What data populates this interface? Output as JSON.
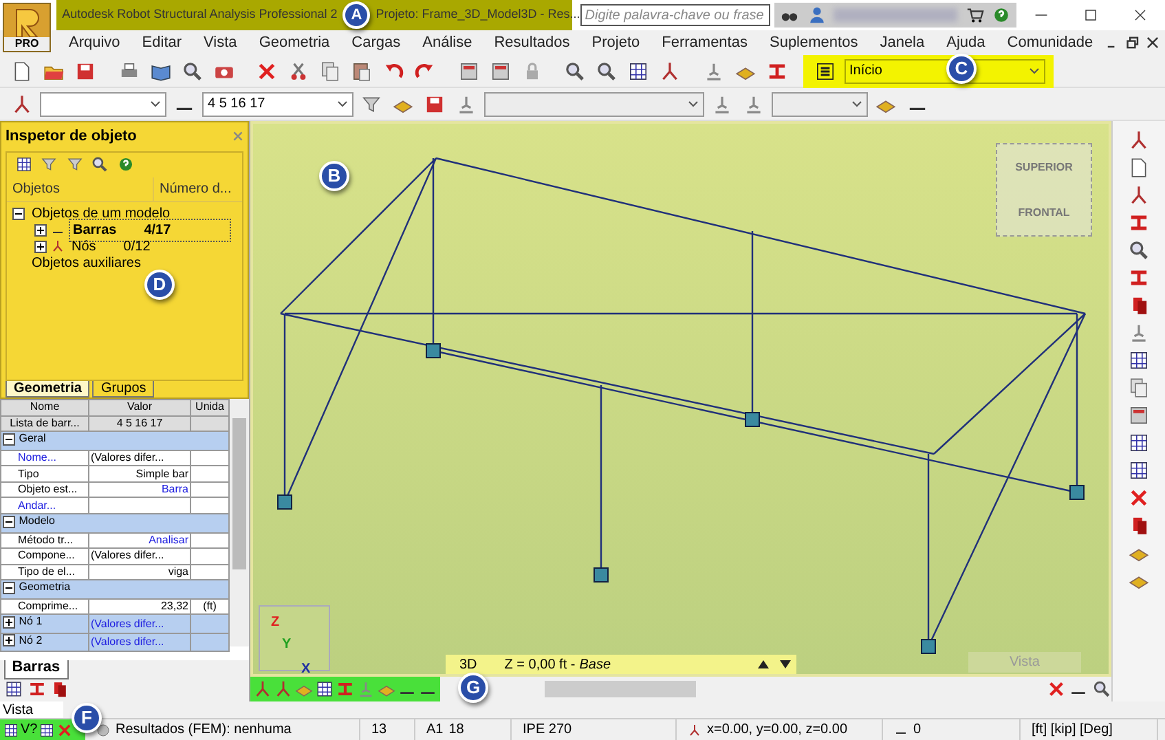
{
  "title_bar": {
    "app_button_label": "PRO",
    "title_parts": [
      "Autodesk Robot Structural Analysis Professional 2",
      "Projeto: Frame_3D_Model3D - Res..."
    ],
    "search": {
      "placeholder": "Digite palavra-chave ou frase"
    }
  },
  "menu": [
    "Arquivo",
    "Editar",
    "Vista",
    "Geometria",
    "Cargas",
    "Análise",
    "Resultados",
    "Projeto",
    "Ferramentas",
    "Suplementos",
    "Janela",
    "Ajuda",
    "Comunidade"
  ],
  "toolbar": {
    "bar_selection": "4 5 16 17",
    "layout": "Início"
  },
  "inspector": {
    "title": "Inspetor de objeto",
    "columns": [
      "Objetos",
      "Número d..."
    ],
    "tree": [
      {
        "label": "Objetos de um modelo",
        "expanded": true,
        "children": [
          {
            "label": "Barras",
            "count": "4/17",
            "selected": true,
            "expanded": false
          },
          {
            "label": "Nós",
            "count": "0/12",
            "selected": false,
            "expanded": false
          }
        ]
      },
      {
        "label": "Objetos auxiliares"
      }
    ],
    "tabs": [
      {
        "label": "Geometria",
        "selected": true
      },
      {
        "label": "Grupos",
        "selected": false
      }
    ]
  },
  "properties": {
    "columns": [
      "Nome",
      "Valor",
      "Unida"
    ],
    "rows": [
      {
        "kind": "head",
        "name": "Lista de barr...",
        "value": "4 5 16 17"
      },
      {
        "kind": "group",
        "name": "Geral"
      },
      {
        "kind": "row",
        "name": "Nome...",
        "name_link": true,
        "value": "(Valores difer...",
        "value_link": false
      },
      {
        "kind": "row",
        "name": "Tipo",
        "value": "Simple bar",
        "value_link": false
      },
      {
        "kind": "row",
        "name": "Objeto est...",
        "value": "Barra",
        "value_link": true
      },
      {
        "kind": "row",
        "name": "Andar...",
        "name_link": true
      },
      {
        "kind": "group",
        "name": "Modelo"
      },
      {
        "kind": "row",
        "name": "Método tr...",
        "value": "Analisar",
        "value_link": true
      },
      {
        "kind": "row",
        "name": "Compone...",
        "value": "(Valores difer...",
        "value_link": false
      },
      {
        "kind": "row",
        "name": "Tipo de el...",
        "value": "viga",
        "value_link": false
      },
      {
        "kind": "group",
        "name": "Geometria"
      },
      {
        "kind": "row",
        "name": "Comprime...",
        "value": "23,32",
        "value_link": false,
        "unit": "(ft)"
      },
      {
        "kind": "subgroup",
        "name": "Nó 1",
        "value": "(Valores difer..."
      },
      {
        "kind": "subgroup",
        "name": "Nó 2",
        "value": "(Valores difer..."
      }
    ],
    "tab": "Barras"
  },
  "viewport": {
    "cube_faces": [
      "SUPERIOR",
      "FRONTAL"
    ],
    "axes": [
      "Z",
      "Y",
      "X"
    ],
    "view_tabs": [
      {
        "label": "3D"
      },
      {
        "label": "Z = 0,00 ft - *Base*"
      }
    ],
    "view_name": "Vista"
  },
  "command_line": "Vista",
  "status_bar": {
    "tool_text": "V?",
    "results": "Resultados (FEM): nenhuma",
    "node_count": "13",
    "section_label": "A1",
    "bar_count": "18",
    "section": "IPE 270",
    "coordinates": "x=0.00, y=0.00, z=0.00",
    "load_case": "0",
    "units": "[ft] [kip] [Deg]"
  },
  "callouts": [
    {
      "label": "A"
    },
    {
      "label": "B"
    },
    {
      "label": "C"
    },
    {
      "label": "D"
    },
    {
      "label": "F"
    },
    {
      "label": "G"
    }
  ]
}
